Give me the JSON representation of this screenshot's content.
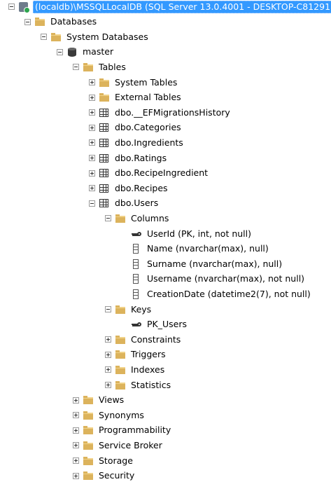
{
  "tree": [
    {
      "label": "(localdb)\\MSSQLLocalDB (SQL Server 13.0.4001 - DESKTOP-C81291",
      "icon": "server-icon",
      "level": 0,
      "exp": "minus",
      "selected": true
    },
    {
      "label": "Databases",
      "icon": "folder-icon",
      "level": 1,
      "exp": "minus"
    },
    {
      "label": "System Databases",
      "icon": "folder-icon",
      "level": 2,
      "exp": "minus"
    },
    {
      "label": "master",
      "icon": "database-icon",
      "level": 3,
      "exp": "minus"
    },
    {
      "label": "Tables",
      "icon": "folder-icon",
      "level": 4,
      "exp": "minus"
    },
    {
      "label": "System Tables",
      "icon": "folder-icon",
      "level": 5,
      "exp": "plus"
    },
    {
      "label": "External Tables",
      "icon": "folder-icon",
      "level": 5,
      "exp": "plus"
    },
    {
      "label": "dbo.__EFMigrationsHistory",
      "icon": "table-icon",
      "level": 5,
      "exp": "plus"
    },
    {
      "label": "dbo.Categories",
      "icon": "table-icon",
      "level": 5,
      "exp": "plus"
    },
    {
      "label": "dbo.Ingredients",
      "icon": "table-icon",
      "level": 5,
      "exp": "plus"
    },
    {
      "label": "dbo.Ratings",
      "icon": "table-icon",
      "level": 5,
      "exp": "plus"
    },
    {
      "label": "dbo.RecipeIngredient",
      "icon": "table-icon",
      "level": 5,
      "exp": "plus"
    },
    {
      "label": "dbo.Recipes",
      "icon": "table-icon",
      "level": 5,
      "exp": "plus"
    },
    {
      "label": "dbo.Users",
      "icon": "table-icon",
      "level": 5,
      "exp": "minus"
    },
    {
      "label": "Columns",
      "icon": "folder-icon",
      "level": 6,
      "exp": "minus"
    },
    {
      "label": "UserId (PK, int, not null)",
      "icon": "key-icon",
      "level": 7,
      "exp": "none"
    },
    {
      "label": "Name (nvarchar(max), null)",
      "icon": "column-icon",
      "level": 7,
      "exp": "none"
    },
    {
      "label": "Surname (nvarchar(max), null)",
      "icon": "column-icon",
      "level": 7,
      "exp": "none"
    },
    {
      "label": "Username (nvarchar(max), not null)",
      "icon": "column-icon",
      "level": 7,
      "exp": "none"
    },
    {
      "label": "CreationDate (datetime2(7), not null)",
      "icon": "column-icon",
      "level": 7,
      "exp": "none"
    },
    {
      "label": "Keys",
      "icon": "folder-icon",
      "level": 6,
      "exp": "minus"
    },
    {
      "label": "PK_Users",
      "icon": "key-icon",
      "level": 7,
      "exp": "none"
    },
    {
      "label": "Constraints",
      "icon": "folder-icon",
      "level": 6,
      "exp": "plus"
    },
    {
      "label": "Triggers",
      "icon": "folder-icon",
      "level": 6,
      "exp": "plus"
    },
    {
      "label": "Indexes",
      "icon": "folder-icon",
      "level": 6,
      "exp": "plus"
    },
    {
      "label": "Statistics",
      "icon": "folder-icon",
      "level": 6,
      "exp": "plus"
    },
    {
      "label": "Views",
      "icon": "folder-icon",
      "level": 4,
      "exp": "plus"
    },
    {
      "label": "Synonyms",
      "icon": "folder-icon",
      "level": 4,
      "exp": "plus"
    },
    {
      "label": "Programmability",
      "icon": "folder-icon",
      "level": 4,
      "exp": "plus"
    },
    {
      "label": "Service Broker",
      "icon": "folder-icon",
      "level": 4,
      "exp": "plus"
    },
    {
      "label": "Storage",
      "icon": "folder-icon",
      "level": 4,
      "exp": "plus"
    },
    {
      "label": "Security",
      "icon": "folder-icon",
      "level": 4,
      "exp": "plus"
    }
  ],
  "colors": {
    "selection": "#3399ff",
    "folder": "#dcb35c"
  }
}
